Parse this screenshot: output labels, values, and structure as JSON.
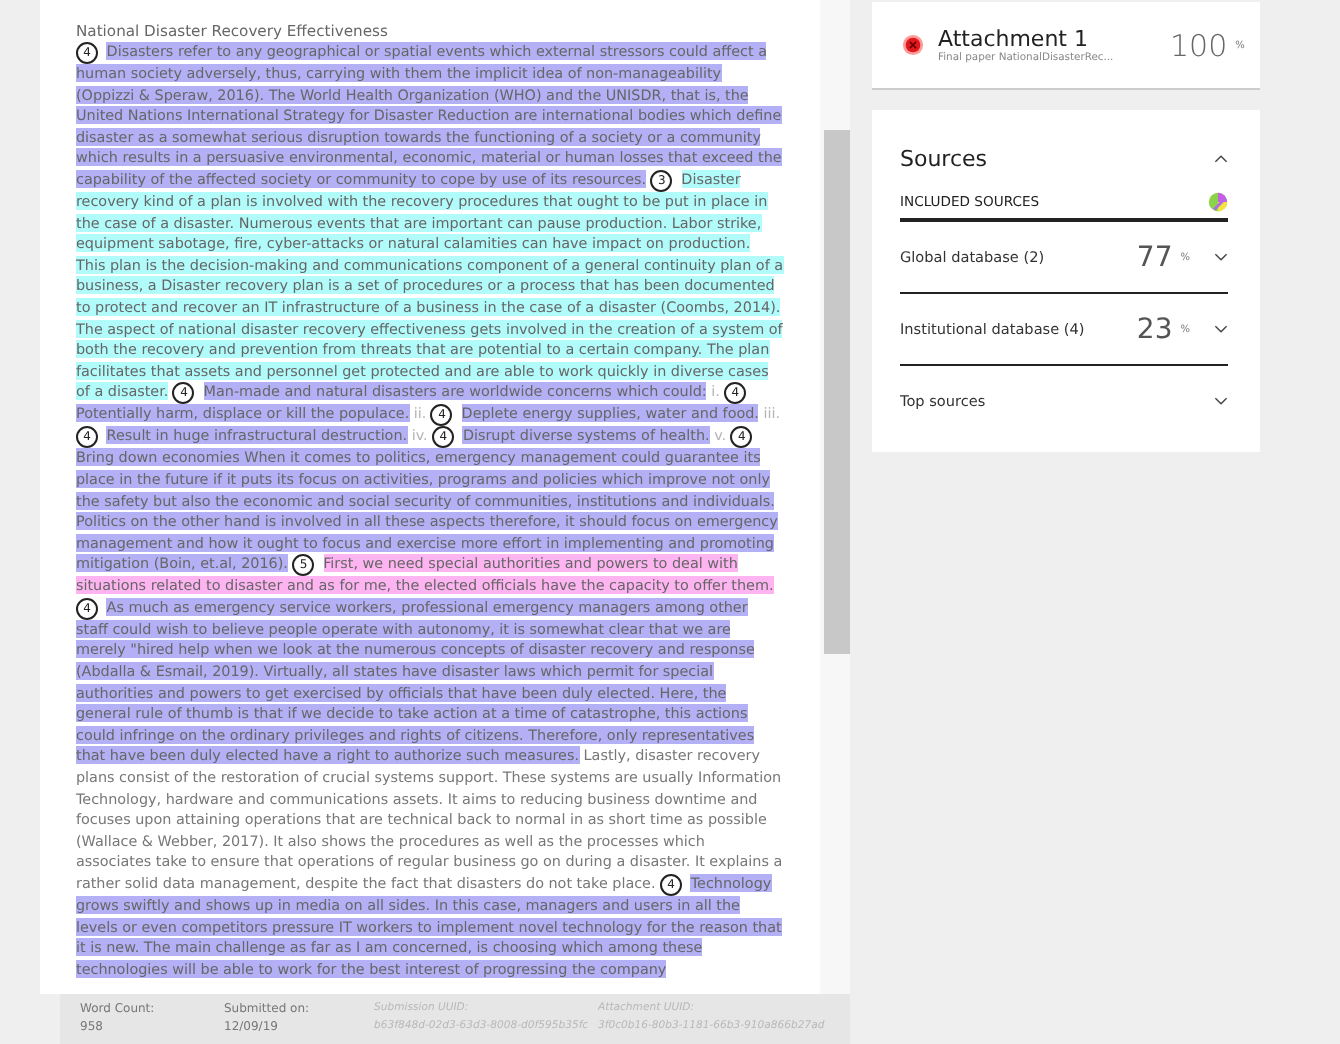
{
  "document": {
    "title": "National Disaster Recovery Effectiveness",
    "segments": [
      {
        "kind": "match",
        "source": "4",
        "color": "#b4b0f6",
        "text": "Disasters refer to any geographical or spatial events which external stressors could affect a human society adversely, thus, carrying with them the implicit idea of non-manageability (Oppizzi & Speraw, 2016). The World Health Organization (WHO) and the UNISDR, that is, the United Nations International Strategy for Disaster Reduction are international bodies which define disaster as a somewhat serious disruption towards the functioning of a society or a community which results in a persuasive environmental, economic, material or human losses that exceed the capability of the affected society or community to cope by use of its resources."
      },
      {
        "kind": "match",
        "source": "3",
        "color": "#b2fbfb",
        "text": "Disaster recovery kind of a plan is involved with the recovery procedures that ought to be put in place in the case of a disaster. Numerous events that are important can pause production. Labor strike, equipment sabotage, fire, cyber-attacks or natural calamities can have impact on production. This plan is the decision-making and communications component of a general continuity plan of a business, a Disaster recovery plan is a set of procedures or a process that has been documented to protect and recover an IT infrastructure of a business in the case of a disaster (Coombs, 2014). The aspect of national disaster recovery effectiveness gets involved in the creation of a system of both the recovery and prevention from threats that are potential to a certain company. The plan facilitates that assets and personnel get protected and are able to work quickly in diverse cases of a disaster."
      },
      {
        "kind": "match",
        "source": "4",
        "color": "#b4b0f6",
        "text": "Man-made and natural disasters are worldwide concerns which could:"
      },
      {
        "kind": "enum",
        "text": "i."
      },
      {
        "kind": "match",
        "source": "4",
        "color": "#b4b0f6",
        "text": "Potentially harm, displace or kill the populace."
      },
      {
        "kind": "enum",
        "text": "ii."
      },
      {
        "kind": "match",
        "source": "4",
        "color": "#b4b0f6",
        "text": "Deplete energy supplies, water and food."
      },
      {
        "kind": "enum",
        "text": "iii."
      },
      {
        "kind": "match",
        "source": "4",
        "color": "#b4b0f6",
        "text": "Result in huge infrastructural destruction."
      },
      {
        "kind": "enum",
        "text": "iv."
      },
      {
        "kind": "match",
        "source": "4",
        "color": "#b4b0f6",
        "text": "Disrupt diverse systems of health."
      },
      {
        "kind": "enum",
        "text": "v."
      },
      {
        "kind": "match",
        "source": "4",
        "color": "#b4b0f6",
        "text": "Bring down economies When it comes to politics, emergency management could guarantee its place in the future if it puts its focus on activities, programs and policies which improve not only the safety but also the economic and social security of communities, institutions and individuals. Politics on the other hand is involved in all these aspects therefore, it should focus on emergency management and how it ought to focus and exercise more effort in implementing and promoting mitigation (Boin, et.al, 2016)."
      },
      {
        "kind": "match",
        "source": "5",
        "color": "#ffb4f2",
        "text": "First, we need special authorities and powers to deal with situations related to disaster and as for me, the elected officials have the capacity to offer them."
      },
      {
        "kind": "match",
        "source": "4",
        "color": "#b4b0f6",
        "text": "As much as emergency service workers, professional emergency managers among other staff could wish to believe people operate with autonomy, it is somewhat clear that we are merely \"hired help when we look at the numerous concepts of disaster recovery and response (Abdalla & Esmail, 2019). Virtually, all states have disaster laws which permit for special authorities and powers to get exercised by officials that have been duly elected. Here, the general rule of thumb is that if we decide to take action at a time of catastrophe, this actions could infringe on the ordinary privileges and rights of citizens. Therefore, only representatives that have been duly elected have a right to authorize such measures."
      },
      {
        "kind": "text",
        "text": "Lastly, disaster recovery plans consist of the restoration of crucial systems support. These systems are usually Information Technology, hardware and communications assets. It aims to reducing business downtime and focuses upon attaining operations that are technical back to normal in as short time as possible (Wallace & Webber, 2017). It also shows the procedures as well as the processes which associates take to ensure that operations of regular business go on during a disaster. It explains a rather solid data management, despite the fact that disasters do not take place."
      },
      {
        "kind": "match",
        "source": "4",
        "color": "#b4b0f6",
        "text": "Technology grows swiftly and shows up in media on all sides. In this case, managers and users in all the levels or even competitors pressure IT workers to implement novel technology for the reason that it is new. The main challenge as far as I am concerned, is choosing which among these technologies will be able to work for the best interest of progressing the company"
      }
    ]
  },
  "footer": [
    {
      "label": "Word Count:",
      "value": "958",
      "kind": "plain"
    },
    {
      "label": "Submitted on:",
      "value": "12/09/19",
      "kind": "plain"
    },
    {
      "label": "Submission UUID:",
      "value": "b63f848d-02d3-63d3-8008-d0f595b35fc",
      "kind": "faded"
    },
    {
      "label": "Attachment UUID:",
      "value": "3f0c0b16-80b3-1181-66b3-910a866b27ad",
      "kind": "faded"
    }
  ],
  "attachment": {
    "title": "Attachment 1",
    "subtitle": "Final paper NationalDisasterRec...",
    "score": "100",
    "unit": "%"
  },
  "sources": {
    "title": "Sources",
    "expanded": true,
    "tab": "INCLUDED SOURCES",
    "groups": [
      {
        "label": "Global database (2)",
        "score": "77",
        "unit": "%"
      },
      {
        "label": "Institutional database (4)",
        "score": "23",
        "unit": "%"
      },
      {
        "label": "Top sources"
      }
    ]
  }
}
